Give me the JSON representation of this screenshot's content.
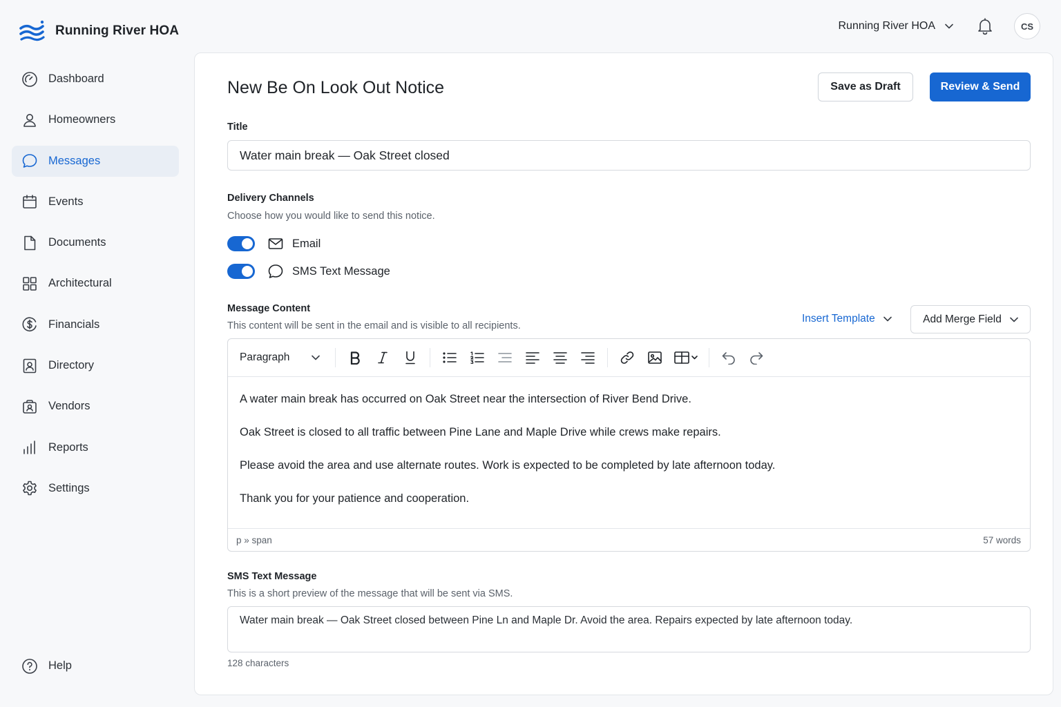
{
  "brand": {
    "name": "Running River HOA"
  },
  "topbar": {
    "org_name": "Running River HOA",
    "avatar_initials": "CS"
  },
  "sidebar": {
    "items": [
      {
        "label": "Dashboard",
        "icon": "dashboard-icon",
        "active": false
      },
      {
        "label": "Homeowners",
        "icon": "user-icon",
        "active": false
      },
      {
        "label": "Messages",
        "icon": "chat-bubble-icon",
        "active": true
      },
      {
        "label": "Events",
        "icon": "calendar-icon",
        "active": false
      },
      {
        "label": "Documents",
        "icon": "document-icon",
        "active": false
      },
      {
        "label": "Architectural",
        "icon": "grid-icon",
        "active": false
      },
      {
        "label": "Financials",
        "icon": "dollar-icon",
        "active": false
      },
      {
        "label": "Directory",
        "icon": "contact-card-icon",
        "active": false
      },
      {
        "label": "Vendors",
        "icon": "vendor-icon",
        "active": false
      },
      {
        "label": "Reports",
        "icon": "bar-chart-icon",
        "active": false
      },
      {
        "label": "Settings",
        "icon": "gear-icon",
        "active": false
      }
    ],
    "help_label": "Help"
  },
  "page": {
    "title": "New Be On Look Out Notice",
    "save_draft_label": "Save as Draft",
    "review_send_label": "Review & Send"
  },
  "form": {
    "title_label": "Title",
    "title_value": "Water main break — Oak Street closed",
    "channels_label": "Delivery Channels",
    "channels_help": "Choose how you would like to send this notice.",
    "channels": [
      {
        "label": "Email",
        "enabled": true,
        "icon": "mail-icon"
      },
      {
        "label": "SMS Text Message",
        "enabled": true,
        "icon": "chat-bubble-icon"
      }
    ],
    "content_label": "Message Content",
    "content_help": "This content will be sent in the email and is visible to all recipients.",
    "insert_template_label": "Insert Template",
    "merge_field_label": "Add Merge Field",
    "paragraph_style": "Paragraph",
    "body_paragraphs": [
      "A water main break has occurred on Oak Street near the intersection of River Bend Drive.",
      "Oak Street is closed to all traffic between Pine Lane and Maple Drive while crews make repairs.",
      "Please avoid the area and use alternate routes. Work is expected to be completed by late afternoon today.",
      "Thank you for your patience and cooperation."
    ],
    "editor_path": "p » span",
    "word_count": "57 words",
    "sms_label": "SMS Text Message",
    "sms_help": "This is a short preview of the message that will be sent via SMS.",
    "sms_value": "Water main break — Oak Street closed between Pine Ln and Maple Dr. Avoid the area. Repairs expected by late afternoon today.",
    "sms_char_count": "128 characters"
  },
  "colors": {
    "accent": "#1767d2",
    "active_bg": "#e9eef5",
    "border": "#d6d9de"
  }
}
